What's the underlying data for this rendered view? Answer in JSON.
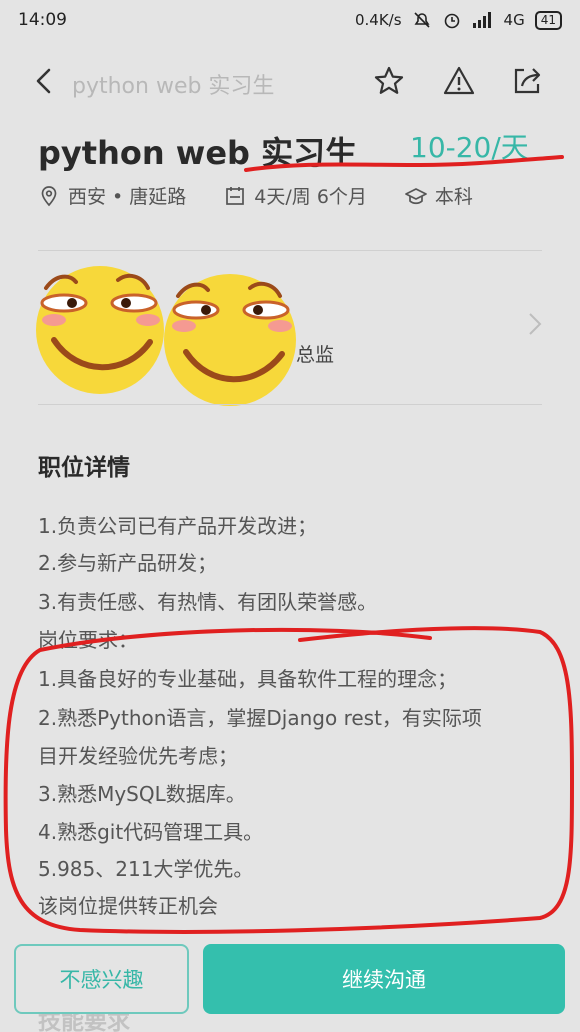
{
  "status_bar": {
    "time": "14:09",
    "network_speed": "0.4K/s",
    "signal": "4G",
    "battery": "41"
  },
  "nav": {
    "title": "python web 实习生"
  },
  "job": {
    "title": "python web 实习生",
    "salary": "10-20/天",
    "location": "西安 • 唐延路",
    "schedule": "4天/周 6个月",
    "education": "本科"
  },
  "recruiter": {
    "role": "总监"
  },
  "details": {
    "section_title": "职位详情",
    "lines": [
      "1.负责公司已有产品开发改进；",
      "2.参与新产品研发；",
      "3.有责任感、有热情、有团队荣誉感。",
      "岗位要求：",
      "1.具备良好的专业基础，具备软件工程的理念；",
      "2.熟悉Python语言，掌握Django rest，有实际项",
      "目开发经验优先考虑；",
      "3.熟悉MySQL数据库。",
      "4.熟悉git代码管理工具。",
      "5.985、211大学优先。",
      "该岗位提供转正机会"
    ]
  },
  "actions": {
    "decline": "不感兴趣",
    "continue": "继续沟通"
  },
  "next_section": {
    "title": "技能要求"
  },
  "colors": {
    "accent": "#34bfad",
    "salary": "#37b7a7",
    "annotation": "#e02020",
    "emoji": "#f7d83a"
  }
}
